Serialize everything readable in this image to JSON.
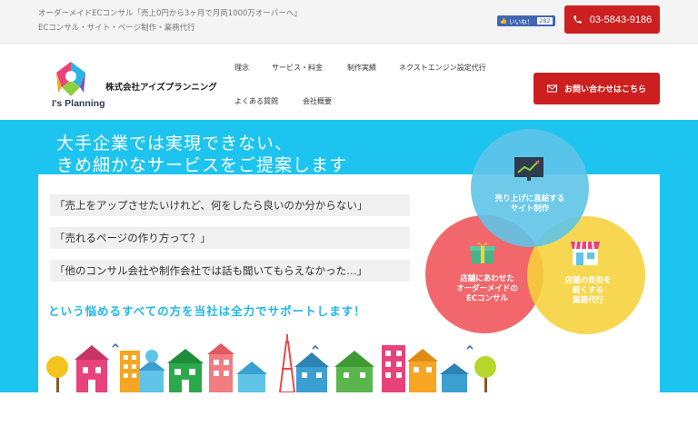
{
  "topbar": {
    "tagline1": "オーダーメイドECコンサル「売上0円から3ヶ月で月商1000万オーバーへ」",
    "tagline2": "ECコンサル・サイト・ページ制作・業務代行",
    "like_label": "いいね！",
    "like_count": "282",
    "phone": "03-5843-9186"
  },
  "header": {
    "logo_text": "I's Planning",
    "company": "株式会社アイズプランニング",
    "nav": [
      "理念",
      "サービス・料金",
      "制作実績",
      "ネクストエンジン設定代行",
      "よくある質問",
      "会社概要"
    ],
    "contact_label": "お問い合わせはこちら"
  },
  "hero": {
    "headline1": "大手企業では実現できない、",
    "headline2": "きめ細かなサービスをご提案します",
    "quotes": [
      "「売上をアップさせたいけれど、何をしたら良いのか分からない」",
      "「売れるページの作り方って？」",
      "「他のコンサル会社や制作会社では話も聞いてもらえなかった…」"
    ],
    "support": "という悩めるすべての方を当社は全力でサポートします！",
    "circles": [
      {
        "label": "売り上げに直結する\nサイト制作",
        "color": "#5fc4e8"
      },
      {
        "label": "店舗にあわせた\nオーダーメイドの\nECコンサル",
        "color": "#f05a5e"
      },
      {
        "label": "店舗の負担を\n軽くする\n業務代行",
        "color": "#f6d13a"
      }
    ]
  },
  "colors": {
    "accent_red": "#cc1f1f",
    "hero_blue": "#1ec4f0",
    "support_blue": "#21b8e8"
  },
  "icons": [
    "facebook-thumb-icon",
    "phone-icon",
    "mail-icon",
    "chart-icon",
    "gift-icon",
    "shop-icon"
  ]
}
